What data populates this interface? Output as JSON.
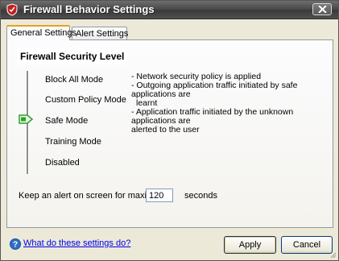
{
  "window": {
    "title": "Firewall Behavior Settings"
  },
  "tabs": [
    {
      "label": "General Settings",
      "active": true
    },
    {
      "label": "Alert Settings",
      "active": false
    }
  ],
  "security": {
    "title": "Firewall Security Level",
    "levels": [
      "Block All Mode",
      "Custom Policy Mode",
      "Safe Mode",
      "Training Mode",
      "Disabled"
    ],
    "selected": "Safe Mode",
    "description": [
      "- Network security policy is applied",
      "- Outgoing application traffic initiated by safe applications are",
      "learnt",
      "- Application traffic initiated by the unknown applications are",
      "alerted to the user"
    ]
  },
  "alert": {
    "label": "Keep an alert on screen for maximum",
    "value": "120",
    "unit": "seconds"
  },
  "footer": {
    "help_link": "What do these settings do?",
    "apply_label": "Apply",
    "cancel_label": "Cancel"
  },
  "icons": {
    "title": "shield-icon",
    "close": "close-icon",
    "slider": "slider-handle-icon",
    "help": "help-icon"
  },
  "colors": {
    "titlebar": "#4a4a4a",
    "tab_highlight": "#e8a320",
    "handle": "#2e9f2e",
    "link": "#0000ee"
  }
}
